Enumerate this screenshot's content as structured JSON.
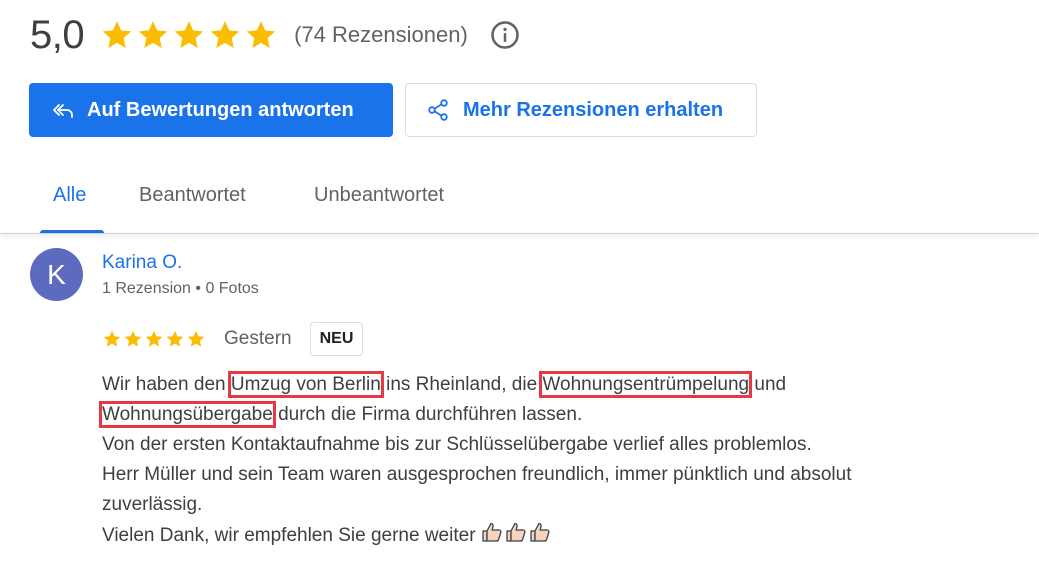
{
  "summary": {
    "rating": "5,0",
    "stars": 5,
    "review_count": "(74 Rezensionen)",
    "info_icon": "info-icon"
  },
  "actions": {
    "reply_label": "Auf Bewertungen antworten",
    "reply_icon": "reply-all-icon",
    "more_label": "Mehr Rezensionen erhalten",
    "more_icon": "share-icon"
  },
  "tabs": [
    {
      "label": "Alle",
      "active": true
    },
    {
      "label": "Beantwortet",
      "active": false
    },
    {
      "label": "Unbeantwortet",
      "active": false
    }
  ],
  "review": {
    "avatar_letter": "K",
    "avatar_color": "#5c6bc0",
    "reviewer_name": "Karina O.",
    "reviewer_meta": "1 Rezension • 0 Fotos",
    "stars": 5,
    "date": "Gestern",
    "badge": "NEU",
    "text": {
      "l1_a": "Wir haben den ",
      "l1_hl1": "Umzug von Berlin",
      "l1_b": " ins Rheinland, die ",
      "l1_hl2": "Wohnungsentrümpelung",
      "l1_c": " und",
      "l2_hl": "Wohnungsübergabe",
      "l2_a": " durch die Firma durchführen lassen.",
      "l3": "Von der ersten Kontaktaufnahme bis zur Schlüsselübergabe verlief alles problemlos.",
      "l4": "Herr Müller und sein Team waren ausgesprochen freundlich, immer pünktlich und absolut",
      "l5": "zuverlässig.",
      "l6": "Vielen Dank, wir empfehlen Sie gerne weiter"
    },
    "emoji_icons": [
      "thumbs-up-icon",
      "thumbs-up-icon",
      "thumbs-up-icon"
    ]
  },
  "colors": {
    "accent": "#1a73e8",
    "star": "#fbbc04",
    "highlight_box": "#e53946"
  }
}
